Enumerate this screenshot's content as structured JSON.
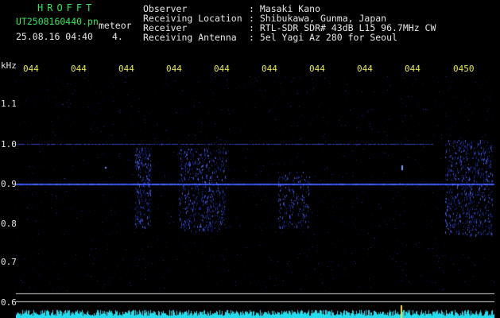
{
  "header": {
    "logo": "HROFFT",
    "filename": "UT2508160440.pn",
    "mode": "meteor",
    "datetime": "25.08.16 04:40",
    "count": "4."
  },
  "info": {
    "observer_label": "Observer",
    "observer_value": ": Masaki Kano",
    "location_label": "Receiving Location",
    "location_value": ": Shibukawa, Gunma, Japan",
    "receiver_label": "Receiver",
    "receiver_value": ": RTL-SDR SDR# 43dB L15 96.7MHz CW",
    "antenna_label": "Receiving Antenna",
    "antenna_value": ": 5el Yagi Az 280 for Seoul"
  },
  "axis": {
    "unit": "kHz",
    "y_ticks": [
      "1.1",
      "1.0",
      "0.9",
      "0.8",
      "0.7",
      "0.6"
    ],
    "x_ticks": [
      "044",
      "044",
      "044",
      "044",
      "044",
      "044",
      "044",
      "044",
      "044",
      "0450"
    ]
  },
  "colors": {
    "bg": "#000000",
    "signal": "#3a55ff",
    "trace": "#22ddee",
    "ping": "#f0e040",
    "gridline": "#cfcfcf"
  }
}
